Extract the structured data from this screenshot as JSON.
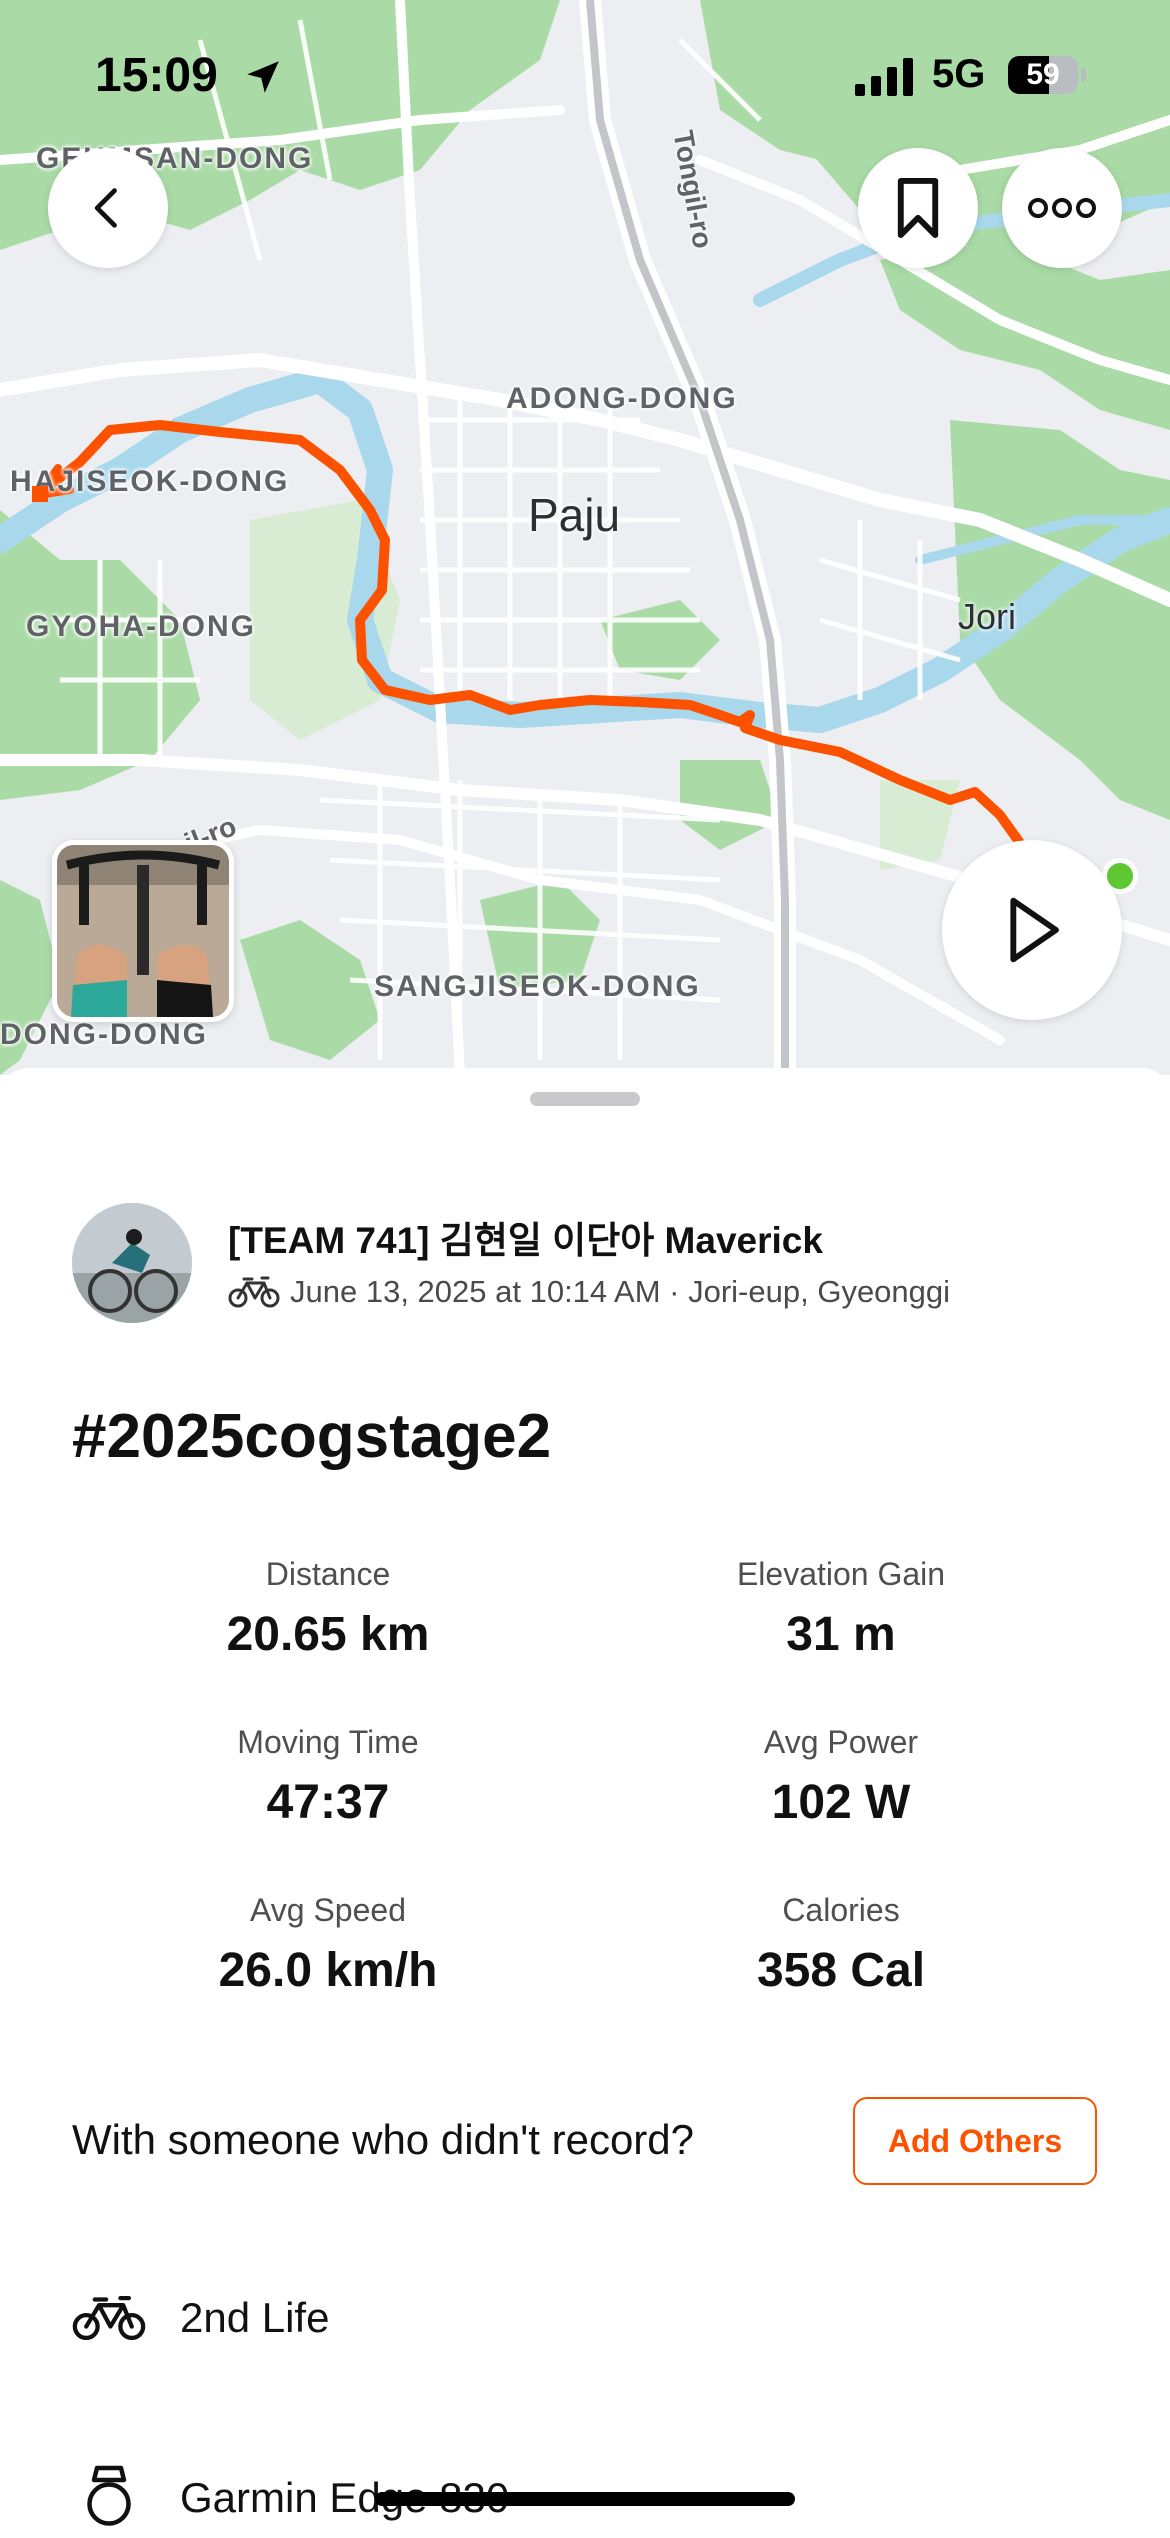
{
  "status_bar": {
    "time": "15:09",
    "network": "5G",
    "battery_level": "59",
    "battery_fraction": 0.59,
    "location_icon": "location-arrow-icon",
    "signal_icon": "cellular-signal-icon"
  },
  "map": {
    "labels": {
      "geumsan": "GEUMSAN-DONG",
      "adong": "ADONG-DONG",
      "hajiseok": "HAJISEOK-DONG",
      "gyoha": "GYOHA-DONG",
      "sangjiseok": "SANGJISEOK-DONG",
      "dong": "DONG-DONG",
      "city": "Paju",
      "town": "Jori",
      "road_tongil": "Tongil-ro",
      "road_sw": "il-ro"
    },
    "route_color": "#fc5200",
    "start_marker_color": "#5dc832",
    "buttons": {
      "back": "chevron-left-icon",
      "bookmark": "bookmark-icon",
      "more": "more-horizontal-icon",
      "play": "play-icon"
    }
  },
  "activity": {
    "athlete": "[TEAM 741] 김현일 이단아 Maverick",
    "meta": "June 13, 2025 at 10:14 AM · Jori-eup, Gyeonggi",
    "sport_icon": "bike-icon",
    "title": "#2025cogstage2",
    "stats": [
      {
        "label": "Distance",
        "value": "20.65 km"
      },
      {
        "label": "Elevation Gain",
        "value": "31 m"
      },
      {
        "label": "Moving Time",
        "value": "47:37"
      },
      {
        "label": "Avg Power",
        "value": "102 W"
      },
      {
        "label": "Avg Speed",
        "value": "26.0 km/h"
      },
      {
        "label": "Calories",
        "value": "358 Cal"
      }
    ],
    "with_someone": "With someone who didn't record?",
    "add_others": "Add Others",
    "gear": [
      {
        "label": "2nd Life",
        "icon": "bike-icon"
      },
      {
        "label": "Garmin Edge 830",
        "icon": "watch-icon"
      }
    ]
  },
  "colors": {
    "accent": "#fc5200",
    "map_bg": "#eceef2",
    "park": "#9fd59a",
    "water": "#a9d8ec"
  }
}
